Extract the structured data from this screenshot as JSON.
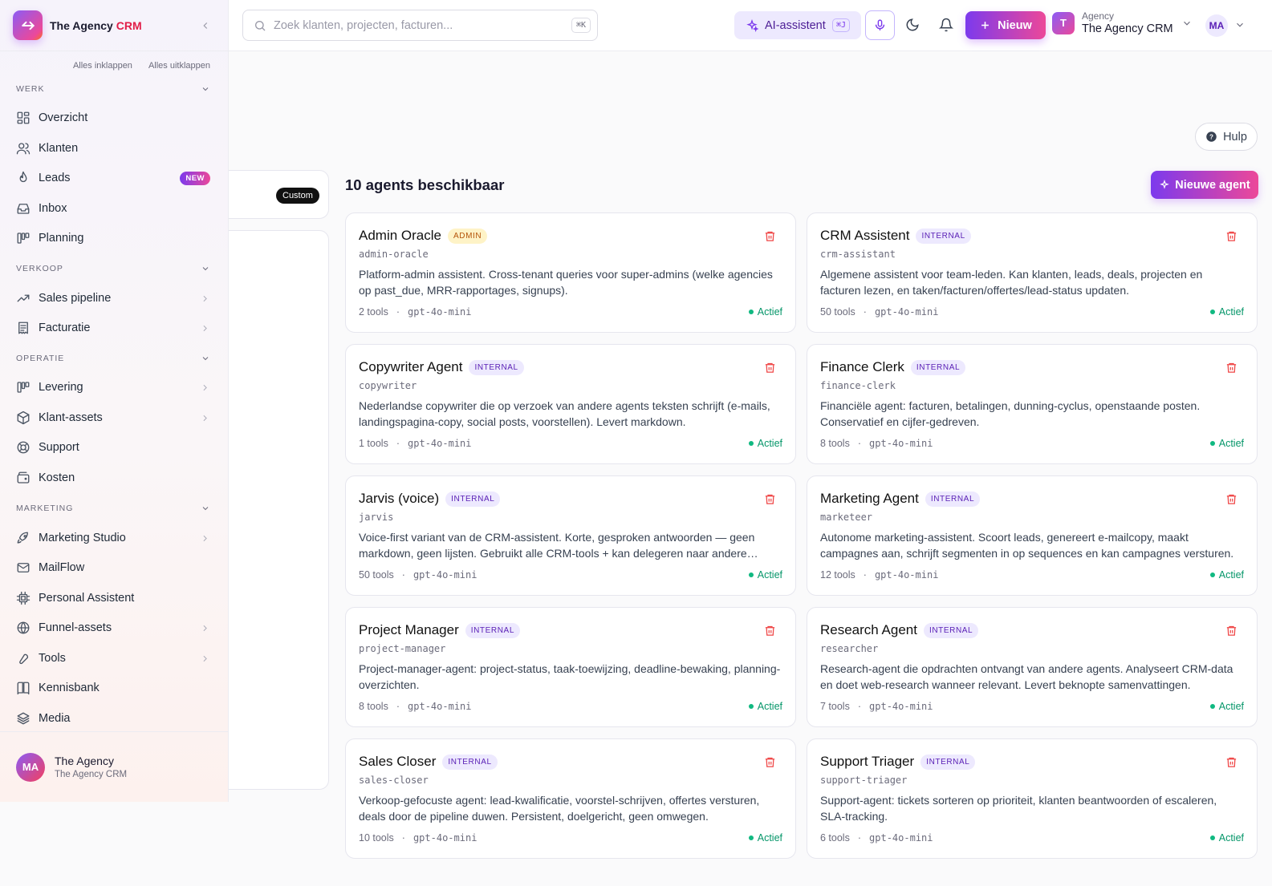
{
  "brand": {
    "name_part1": "The Agency ",
    "name_part2": "CRM"
  },
  "sidebar": {
    "collapse_all": "Alles inklappen",
    "expand_all": "Alles uitklappen",
    "sections": [
      {
        "title": "WERK"
      },
      {
        "title": "VERKOOP"
      },
      {
        "title": "OPERATIE"
      },
      {
        "title": "MARKETING"
      }
    ],
    "items": [
      {
        "label": "Overzicht",
        "icon": "grid-icon"
      },
      {
        "label": "Klanten",
        "icon": "users-icon"
      },
      {
        "label": "Leads",
        "icon": "flame-icon",
        "badge": "NEW"
      },
      {
        "label": "Inbox",
        "icon": "inbox-icon"
      },
      {
        "label": "Planning",
        "icon": "kanban-icon"
      },
      {
        "label": "Sales pipeline",
        "icon": "trending-up-icon"
      },
      {
        "label": "Facturatie",
        "icon": "receipt-icon"
      },
      {
        "label": "Levering",
        "icon": "kanban-icon"
      },
      {
        "label": "Klant-assets",
        "icon": "box-icon"
      },
      {
        "label": "Support",
        "icon": "lifebuoy-icon"
      },
      {
        "label": "Kosten",
        "icon": "wallet-icon"
      },
      {
        "label": "Marketing Studio",
        "icon": "rocket-icon"
      },
      {
        "label": "MailFlow",
        "icon": "mail-icon"
      },
      {
        "label": "Personal Assistent",
        "icon": "cpu-icon"
      },
      {
        "label": "Funnel-assets",
        "icon": "globe-icon"
      },
      {
        "label": "Tools",
        "icon": "wrench-icon"
      },
      {
        "label": "Kennisbank",
        "icon": "book-icon"
      },
      {
        "label": "Media",
        "icon": "layers-icon"
      }
    ],
    "footer": {
      "initials": "MA",
      "name": "The Agency",
      "sub": "The Agency CRM"
    }
  },
  "topbar": {
    "search_placeholder": "Zoek klanten, projecten, facturen...",
    "search_kbd": "⌘K",
    "ai_label": "AI-assistent",
    "ai_kbd": "⌘J",
    "new_label": "Nieuw",
    "tenant_small": "Agency",
    "tenant_name": "The Agency CRM",
    "tenant_initial": "T",
    "user_initials": "MA"
  },
  "main": {
    "help_label": "Hulp",
    "custom_badge": "Custom",
    "count_title": "10 agents beschikbaar",
    "new_agent_label": "Nieuwe agent"
  },
  "agents": [
    {
      "name": "Admin Oracle",
      "tag": "ADMIN",
      "slug": "admin-oracle",
      "desc": "Platform-admin assistent. Cross-tenant queries voor super-admins (welke agencies op past_due, MRR-rapportages, signups).",
      "tools": "2 tools",
      "model": "gpt-4o-mini",
      "status": "Actief"
    },
    {
      "name": "CRM Assistent",
      "tag": "INTERNAL",
      "slug": "crm-assistant",
      "desc": "Algemene assistent voor team-leden. Kan klanten, leads, deals, projecten en facturen lezen, en taken/facturen/offertes/lead-status updaten.",
      "tools": "50 tools",
      "model": "gpt-4o-mini",
      "status": "Actief"
    },
    {
      "name": "Copywriter Agent",
      "tag": "INTERNAL",
      "slug": "copywriter",
      "desc": "Nederlandse copywriter die op verzoek van andere agents teksten schrijft (e-mails, landingspagina-copy, social posts, voorstellen). Levert markdown.",
      "tools": "1 tools",
      "model": "gpt-4o-mini",
      "status": "Actief"
    },
    {
      "name": "Finance Clerk",
      "tag": "INTERNAL",
      "slug": "finance-clerk",
      "desc": "Financiële agent: facturen, betalingen, dunning-cyclus, openstaande posten. Conservatief en cijfer-gedreven.",
      "tools": "8 tools",
      "model": "gpt-4o-mini",
      "status": "Actief"
    },
    {
      "name": "Jarvis (voice)",
      "tag": "INTERNAL",
      "slug": "jarvis",
      "desc": "Voice-first variant van de CRM-assistent. Korte, gesproken antwoorden — geen markdown, geen lijsten. Gebruikt alle CRM-tools + kan delegeren naar andere agents.",
      "tools": "50 tools",
      "model": "gpt-4o-mini",
      "status": "Actief"
    },
    {
      "name": "Marketing Agent",
      "tag": "INTERNAL",
      "slug": "marketeer",
      "desc": "Autonome marketing-assistent. Scoort leads, genereert e-mailcopy, maakt campagnes aan, schrijft segmenten in op sequences en kan campagnes versturen.",
      "tools": "12 tools",
      "model": "gpt-4o-mini",
      "status": "Actief"
    },
    {
      "name": "Project Manager",
      "tag": "INTERNAL",
      "slug": "project-manager",
      "desc": "Project-manager-agent: project-status, taak-toewijzing, deadline-bewaking, planning-overzichten.",
      "tools": "8 tools",
      "model": "gpt-4o-mini",
      "status": "Actief"
    },
    {
      "name": "Research Agent",
      "tag": "INTERNAL",
      "slug": "researcher",
      "desc": "Research-agent die opdrachten ontvangt van andere agents. Analyseert CRM-data en doet web-research wanneer relevant. Levert beknopte samenvattingen.",
      "tools": "7 tools",
      "model": "gpt-4o-mini",
      "status": "Actief"
    },
    {
      "name": "Sales Closer",
      "tag": "INTERNAL",
      "slug": "sales-closer",
      "desc": "Verkoop-gefocuste agent: lead-kwalificatie, voorstel-schrijven, offertes versturen, deals door de pipeline duwen. Persistent, doelgericht, geen omwegen.",
      "tools": "10 tools",
      "model": "gpt-4o-mini",
      "status": "Actief"
    },
    {
      "name": "Support Triager",
      "tag": "INTERNAL",
      "slug": "support-triager",
      "desc": "Support-agent: tickets sorteren op prioriteit, klanten beantwoorden of escaleren, SLA-tracking.",
      "tools": "6 tools",
      "model": "gpt-4o-mini",
      "status": "Actief"
    }
  ]
}
